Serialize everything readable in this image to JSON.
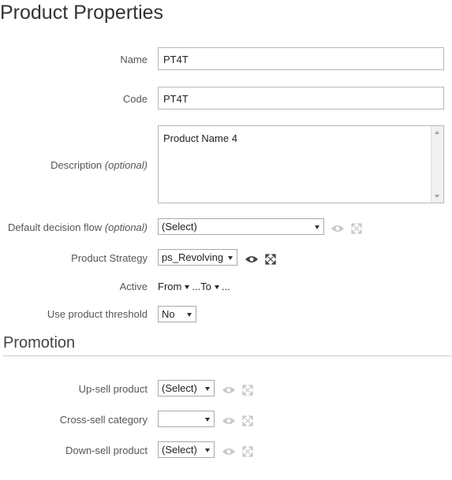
{
  "page": {
    "title": "Product Properties"
  },
  "fields": {
    "name": {
      "label": "Name",
      "value": "PT4T"
    },
    "code": {
      "label": "Code",
      "value": "PT4T"
    },
    "description": {
      "label": "Description",
      "optional": "(optional)",
      "value": "Product Name 4"
    },
    "default_decision_flow": {
      "label": "Default decision flow",
      "optional": "(optional)",
      "value": "(Select)"
    },
    "product_strategy": {
      "label": "Product Strategy",
      "value": "ps_Revolving"
    },
    "active": {
      "label": "Active",
      "from": "From",
      "mid": "...To",
      "end": "..."
    },
    "use_product_threshold": {
      "label": "Use product threshold",
      "value": "No"
    }
  },
  "promotion": {
    "title": "Promotion",
    "up_sell": {
      "label": "Up-sell product",
      "value": "(Select)"
    },
    "cross_sell": {
      "label": "Cross-sell category",
      "value": ""
    },
    "down_sell": {
      "label": "Down-sell product",
      "value": "(Select)"
    }
  },
  "colors": {
    "icon_active": "#444444",
    "icon_disabled": "#c8c8c8"
  }
}
